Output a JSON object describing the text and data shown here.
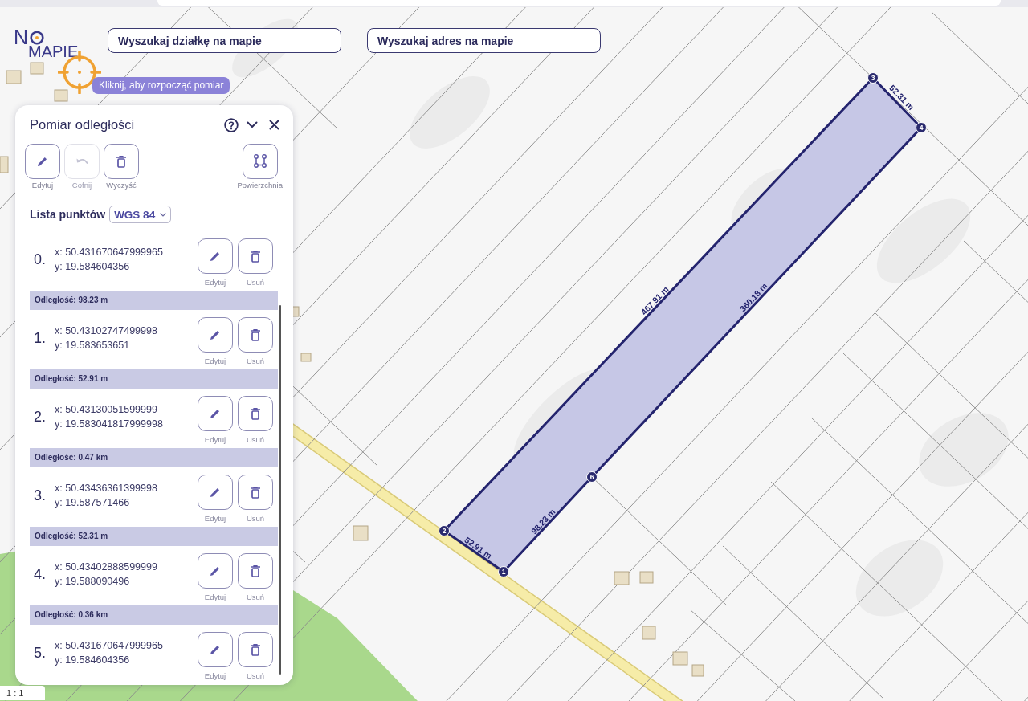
{
  "logo": {
    "letter": "N",
    "word": "MAPIE"
  },
  "search_buttons": [
    {
      "label": "Wyszukaj działkę na mapie"
    },
    {
      "label": "Wyszukaj adres na mapie"
    }
  ],
  "hint": "Kliknij, aby rozpocząć pomiar",
  "panel": {
    "title": "Pomiar odległości",
    "tools": [
      {
        "kind": "edit",
        "label": "Edytuj",
        "disabled": false
      },
      {
        "kind": "undo",
        "label": "Cofnij",
        "disabled": true
      },
      {
        "kind": "clear",
        "label": "Wyczyść",
        "disabled": false
      },
      {
        "kind": "area",
        "label": "Powierzchnia",
        "disabled": false
      }
    ],
    "list_label": "Lista punktów",
    "crs": "WGS 84",
    "points": [
      {
        "index": "0.",
        "x": "x: 50.431670647999965",
        "y": "y: 19.584604356",
        "edit_label": "Edytuj",
        "delete_label": "Usuń",
        "distance": "Odległość: 98.23 m"
      },
      {
        "index": "1.",
        "x": "x: 50.43102747499998",
        "y": "y: 19.583653651",
        "edit_label": "Edytuj",
        "delete_label": "Usuń",
        "distance": "Odległość: 52.91 m"
      },
      {
        "index": "2.",
        "x": "x: 50.43130051599999",
        "y": "y: 19.583041817999998",
        "edit_label": "Edytuj",
        "delete_label": "Usuń",
        "distance": "Odległość: 0.47 km"
      },
      {
        "index": "3.",
        "x": "x: 50.43436361399998",
        "y": "y: 19.587571466",
        "edit_label": "Edytuj",
        "delete_label": "Usuń",
        "distance": "Odległość: 52.31 m"
      },
      {
        "index": "4.",
        "x": "x: 50.43402888599999",
        "y": "y: 19.588090496",
        "edit_label": "Edytuj",
        "delete_label": "Usuń",
        "distance": "Odległość: 0.36 km"
      },
      {
        "index": "5.",
        "x": "x: 50.431670647999965",
        "y": "y: 19.584604356",
        "edit_label": "Edytuj",
        "delete_label": "Usuń"
      }
    ]
  },
  "map": {
    "vertices": [
      {
        "label": "1"
      },
      {
        "label": "2"
      },
      {
        "label": "3"
      },
      {
        "label": "4"
      },
      {
        "label": "6"
      }
    ],
    "edge_labels": [
      "52.91 m",
      "98.23 m",
      "467.91 m",
      "360.18 m",
      "52.31 m"
    ],
    "scale": "1 : 1"
  }
}
